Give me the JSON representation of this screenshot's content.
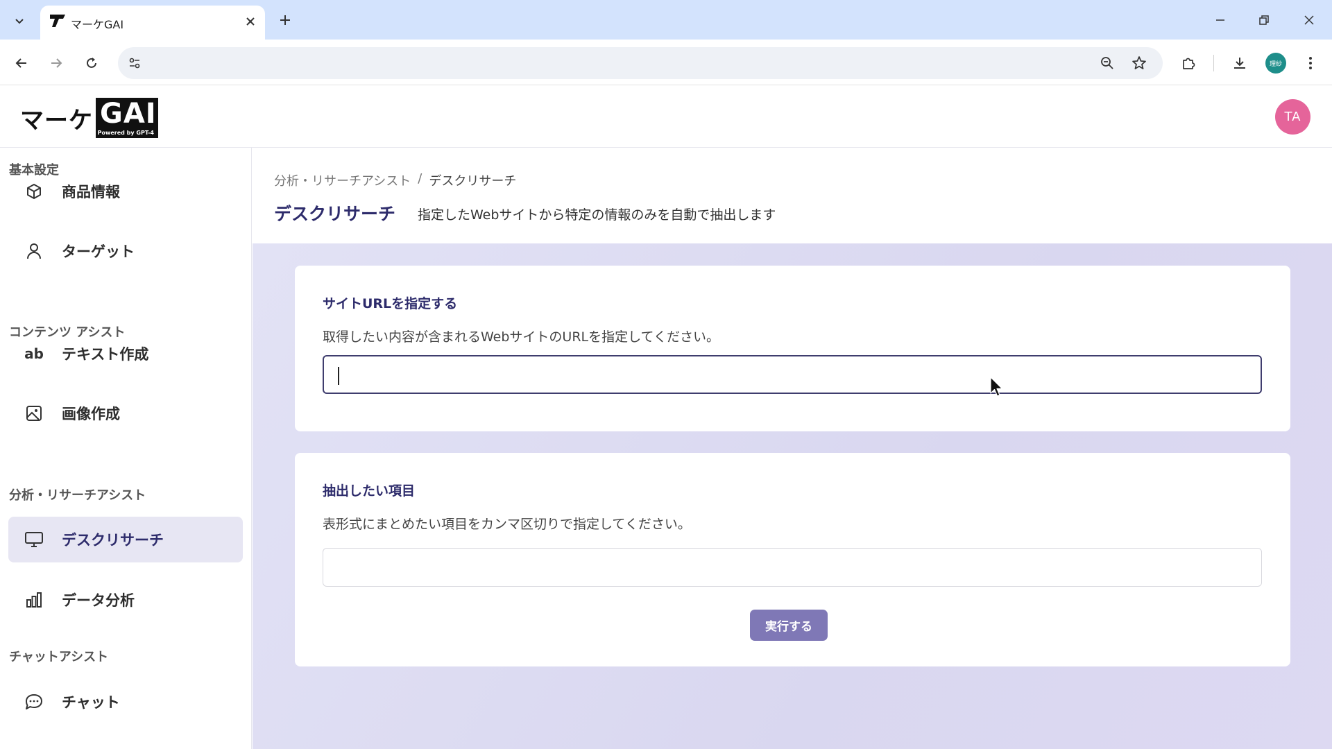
{
  "browser": {
    "tab_title": "マーケGAI",
    "address_value": "",
    "profile_label": "理紗"
  },
  "app": {
    "logo_kana": "マーケ",
    "logo_gai": "GAI",
    "logo_powered": "Powered by GPT-4",
    "avatar_initials": "TA"
  },
  "sidebar": {
    "sections": [
      {
        "heading": "基本設定",
        "items": [
          {
            "label": "商品情報",
            "icon": "box-icon"
          },
          {
            "label": "ターゲット",
            "icon": "person-icon"
          }
        ]
      },
      {
        "heading": "コンテンツ アシスト",
        "items": [
          {
            "label": "テキスト作成",
            "icon": "ab-text-icon"
          },
          {
            "label": "画像作成",
            "icon": "image-icon"
          }
        ]
      },
      {
        "heading": "分析・リサーチアシスト",
        "items": [
          {
            "label": "デスクリサーチ",
            "icon": "monitor-icon",
            "active": true
          },
          {
            "label": "データ分析",
            "icon": "bar-chart-icon"
          }
        ]
      },
      {
        "heading": "チャットアシスト",
        "items": [
          {
            "label": "チャット",
            "icon": "chat-bubble-icon"
          }
        ]
      }
    ],
    "ab_glyph": "ab"
  },
  "main": {
    "breadcrumb": {
      "parent": "分析・リサーチアシスト",
      "separator": "/",
      "current": "デスクリサーチ"
    },
    "title": "デスクリサーチ",
    "description": "指定したWebサイトから特定の情報のみを自動で抽出します",
    "url_card": {
      "title": "サイトURLを指定する",
      "description": "取得したい内容が含まれるWebサイトのURLを指定してください。",
      "value": ""
    },
    "items_card": {
      "title": "抽出したい項目",
      "description": "表形式にまとめたい項目をカンマ区切りで指定してください。",
      "value": ""
    },
    "run_button": "実行する"
  },
  "colors": {
    "accent": "#2d2b6b",
    "button": "#7f78b6",
    "avatar": "#e5649a",
    "active_bg": "#e7e6f3"
  }
}
